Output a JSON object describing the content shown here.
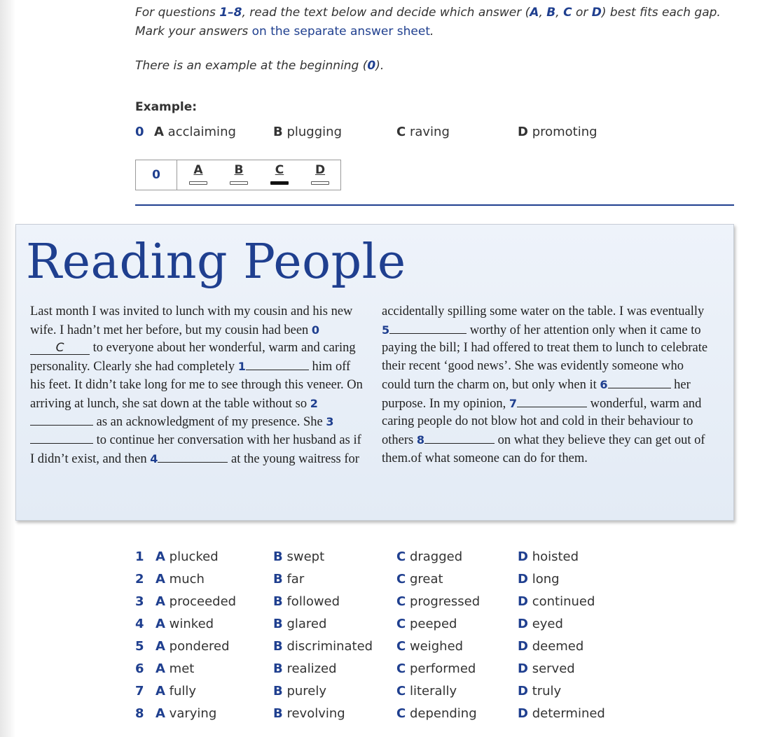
{
  "instructions": {
    "l1_pre": "For questions ",
    "l1_range": "1–8",
    "l1_mid": ", read the text below and decide which answer (",
    "l1_a": "A",
    "l1_sep1": ", ",
    "l1_b": "B",
    "l1_sep2": ", ",
    "l1_c": "C",
    "l1_or": " or ",
    "l1_d": "D",
    "l1_post": ") best fits each gap. Mark your answers ",
    "l1_sheet": "on the separate answer sheet",
    "l1_end": ".",
    "l2_pre": "There is an example at the beginning (",
    "l2_num": "0",
    "l2_end": ")."
  },
  "example": {
    "heading": "Example:",
    "number": "0",
    "options": [
      {
        "letter": "A",
        "word": "acclaiming"
      },
      {
        "letter": "B",
        "word": "plugging"
      },
      {
        "letter": "C",
        "word": "raving"
      },
      {
        "letter": "D",
        "word": "promoting"
      }
    ],
    "box_number": "0",
    "box_letters": [
      "A",
      "B",
      "C",
      "D"
    ],
    "selected": "C"
  },
  "reading": {
    "title": "Reading People",
    "col1": {
      "t1": "Last month I was invited to lunch with my cousin and his new wife. I hadn’t met her before, but my cousin had been ",
      "n0": "0",
      "a0": "C",
      "t2": " to everyone about her wonderful, warm and caring personality. Clearly she had completely ",
      "n1": "1",
      "t3": " him off his feet. It didn’t take long for me to see through this veneer. On arriving at lunch, she sat down at the table without so ",
      "n2": "2",
      "t4": " as an acknowledgment of my presence. She ",
      "n3": "3",
      "t5": " to continue her conversation with her husband as if I didn’t exist, and then ",
      "n4": "4",
      "t6": " at the young waitress for"
    },
    "col2": {
      "t1": "accidentally spilling some water on the table. I was eventually ",
      "n5": "5",
      "t2": " worthy of her attention only when it came to paying the bill; I had offered to treat them to lunch to celebrate their recent ‘good news’. She was evidently someone who could turn the charm on, but only when it ",
      "n6": "6",
      "t3": " her purpose. In my opinion, ",
      "n7": "7",
      "t4": " wonderful, warm and caring people do not blow hot and cold in their behaviour to others ",
      "n8": "8",
      "t5": " on what they believe they can get out of them.of what someone can do for them."
    }
  },
  "answers": [
    {
      "num": "1",
      "A": "plucked",
      "B": "swept",
      "C": "dragged",
      "D": "hoisted"
    },
    {
      "num": "2",
      "A": "much",
      "B": "far",
      "C": "great",
      "D": "long"
    },
    {
      "num": "3",
      "A": "proceeded",
      "B": "followed",
      "C": "progressed",
      "D": "continued"
    },
    {
      "num": "4",
      "A": "winked",
      "B": "glared",
      "C": "peeped",
      "D": "eyed"
    },
    {
      "num": "5",
      "A": "pondered",
      "B": "discriminated",
      "C": "weighed",
      "D": "deemed"
    },
    {
      "num": "6",
      "A": "met",
      "B": "realized",
      "C": "performed",
      "D": "served"
    },
    {
      "num": "7",
      "A": "fully",
      "B": "purely",
      "C": "literally",
      "D": "truly"
    },
    {
      "num": "8",
      "A": "varying",
      "B": "revolving",
      "C": "depending",
      "D": "determined"
    }
  ],
  "letters": {
    "A": "A",
    "B": "B",
    "C": "C",
    "D": "D"
  },
  "colors": {
    "accent": "#1f3f8f",
    "panel_bg": "#e7eef7"
  }
}
